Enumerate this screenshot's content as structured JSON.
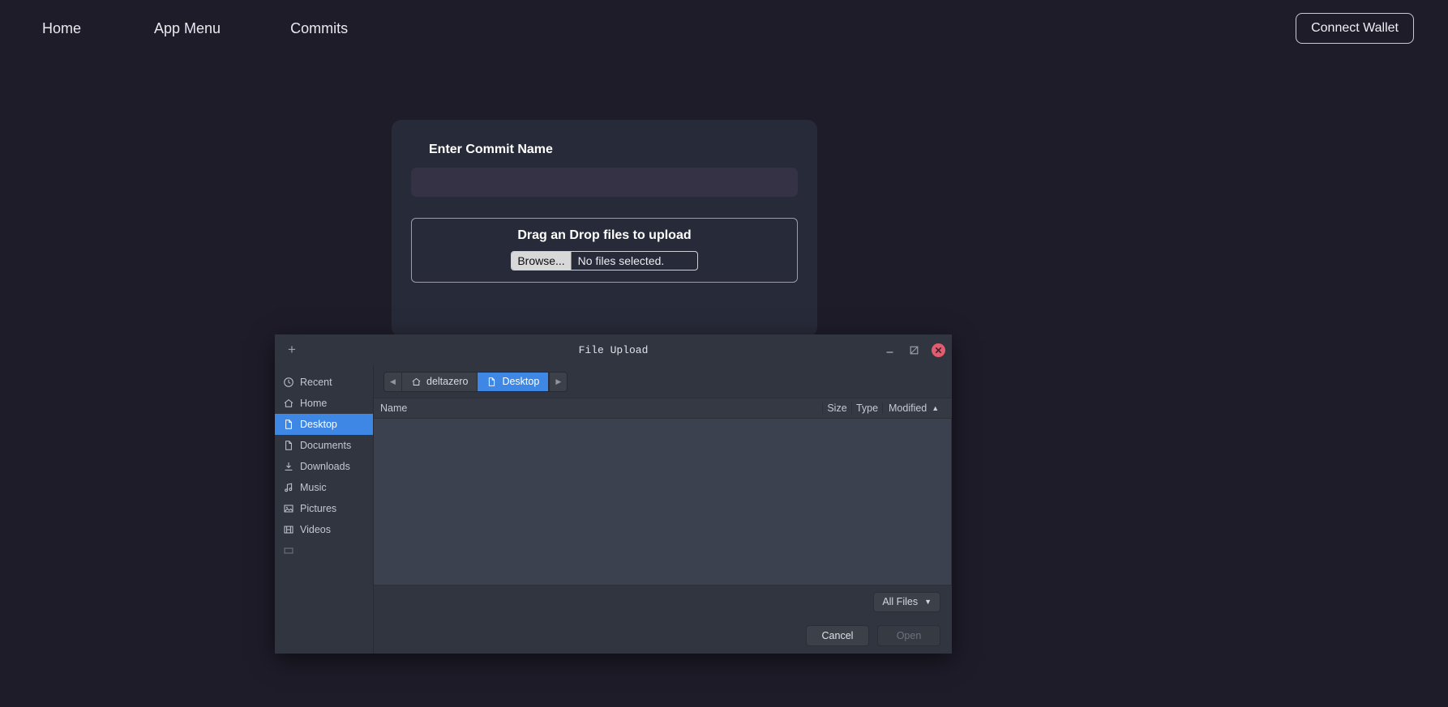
{
  "navbar": {
    "links": [
      {
        "label": "Home",
        "name": "nav-link-home"
      },
      {
        "label": "App Menu",
        "name": "nav-link-app-menu"
      },
      {
        "label": "Commits",
        "name": "nav-link-commits"
      }
    ],
    "connect_wallet_label": "Connect Wallet"
  },
  "commit_card": {
    "label": "Enter Commit Name",
    "input_value": "",
    "input_placeholder": "",
    "dropzone_title": "Drag an Drop files to upload",
    "browse_label": "Browse...",
    "file_status": "No files selected."
  },
  "file_dialog": {
    "title": "File Upload",
    "new_tab_glyph": "+",
    "controls": {
      "minimize": "minimize-icon",
      "maximize": "maximize-icon",
      "close": "close-icon"
    },
    "path_back": "◀",
    "path_forward": "▶",
    "breadcrumbs": [
      {
        "label": "deltazero",
        "icon": "home-icon",
        "active": false
      },
      {
        "label": "Desktop",
        "icon": "file-icon",
        "active": true
      }
    ],
    "places": [
      {
        "label": "Recent",
        "icon": "clock-icon",
        "selected": false
      },
      {
        "label": "Home",
        "icon": "home-icon",
        "selected": false
      },
      {
        "label": "Desktop",
        "icon": "file-icon",
        "selected": true
      },
      {
        "label": "Documents",
        "icon": "document-icon",
        "selected": false
      },
      {
        "label": "Downloads",
        "icon": "download-icon",
        "selected": false
      },
      {
        "label": "Music",
        "icon": "music-icon",
        "selected": false
      },
      {
        "label": "Pictures",
        "icon": "picture-icon",
        "selected": false
      },
      {
        "label": "Videos",
        "icon": "video-icon",
        "selected": false
      }
    ],
    "columns": {
      "name": "Name",
      "size": "Size",
      "type": "Type",
      "modified": "Modified",
      "sort_caret": "▲"
    },
    "files": [],
    "filter_label": "All Files",
    "filter_caret": "▼",
    "cancel_label": "Cancel",
    "open_label": "Open"
  },
  "colors": {
    "page_bg": "#1e1c29",
    "card_bg": "#272a38",
    "input_bg": "#343244",
    "dialog_bg": "#31353f",
    "filelist_bg": "#3b414e",
    "accent_blue": "#3e87e4",
    "close_red": "#e05c6e"
  }
}
